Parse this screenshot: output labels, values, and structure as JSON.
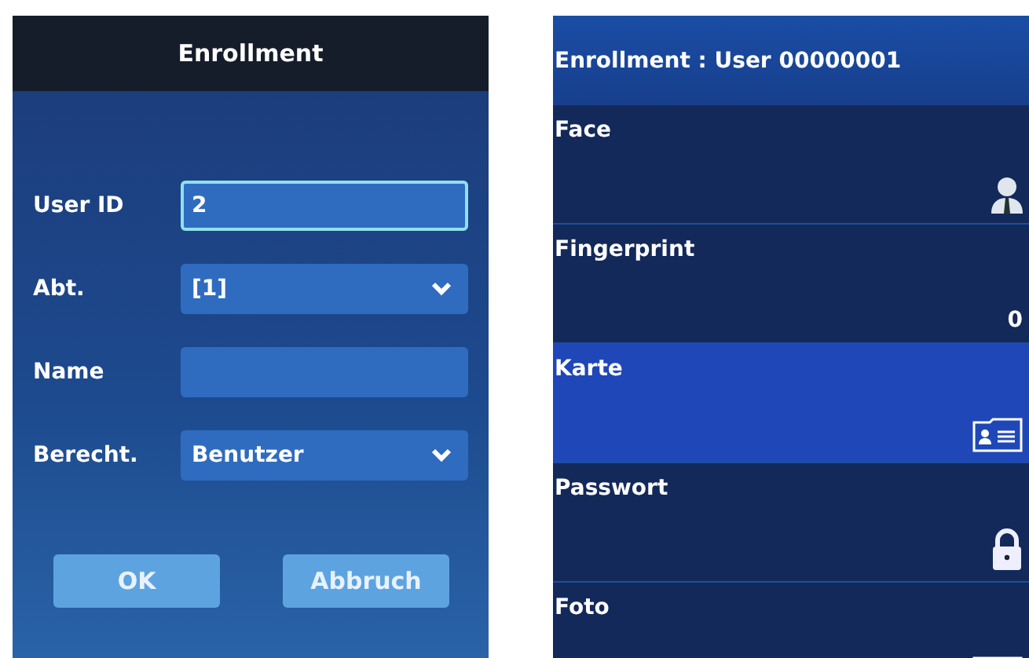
{
  "enroll_form": {
    "title": "Enrollment",
    "fields": [
      {
        "kind": "input",
        "label": "User ID",
        "value": "2",
        "focused": true
      },
      {
        "kind": "select",
        "label": "Abt.",
        "value": "[1]",
        "focused": false
      },
      {
        "kind": "input",
        "label": "Name",
        "focused": false
      },
      {
        "kind": "select",
        "label": "Berecht.",
        "value": "Benutzer",
        "focused": false
      }
    ],
    "buttons": [
      "OK",
      "Abbruch"
    ]
  },
  "enroll_menu": {
    "title": "Enrollment : User 00000001",
    "items": [
      {
        "label": "Face",
        "kind": "face",
        "selected": false
      },
      {
        "label": "Fingerprint",
        "kind": "count",
        "value": "0",
        "selected": false
      },
      {
        "label": "Karte",
        "kind": "card",
        "selected": true
      },
      {
        "label": "Passwort",
        "kind": "lock",
        "selected": false
      },
      {
        "label": "Foto",
        "kind": "photo",
        "selected": false
      }
    ]
  }
}
